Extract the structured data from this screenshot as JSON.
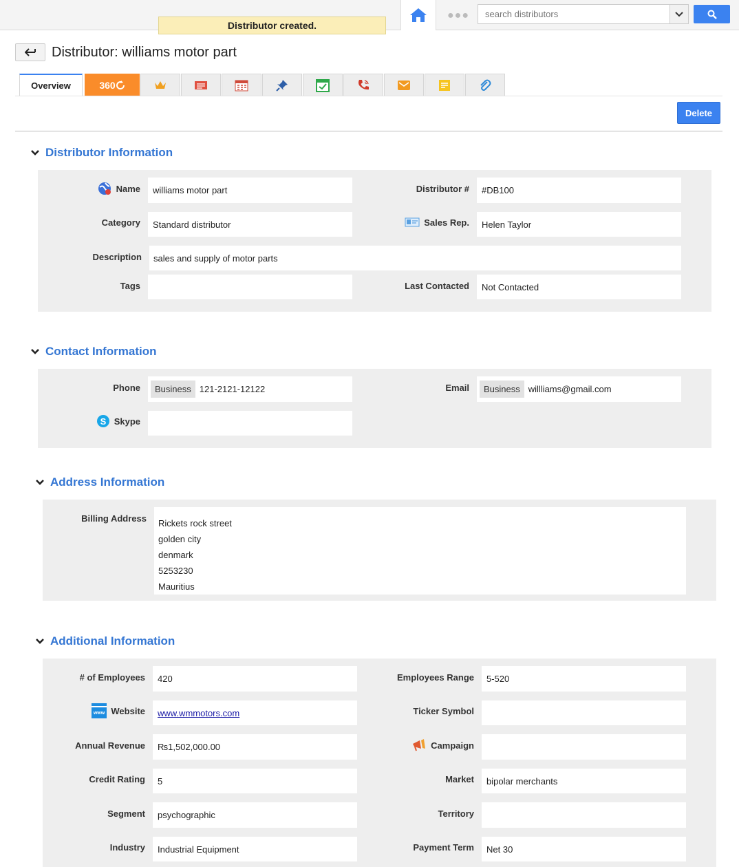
{
  "notice": "Distributor created.",
  "search": {
    "placeholder": "search distributors"
  },
  "page_title": "Distributor: williams motor part",
  "tabs": {
    "overview": "Overview",
    "t360": "360"
  },
  "delete_label": "Delete",
  "sections": {
    "distributor": "Distributor Information",
    "contact": "Contact Information",
    "address": "Address Information",
    "additional": "Additional Information"
  },
  "distributor": {
    "name_label": "Name",
    "name": "williams motor part",
    "number_label": "Distributor #",
    "number": "#DB100",
    "category_label": "Category",
    "category": "Standard distributor",
    "salesrep_label": "Sales Rep.",
    "salesrep": "Helen Taylor",
    "description_label": "Description",
    "description": "sales and supply of motor parts",
    "tags_label": "Tags",
    "tags": "",
    "lastcontacted_label": "Last Contacted",
    "lastcontacted": "Not Contacted"
  },
  "contact": {
    "phone_label": "Phone",
    "phone_type": "Business",
    "phone": "121-2121-12122",
    "email_label": "Email",
    "email_type": "Business",
    "email": "willliams@gmail.com",
    "skype_label": "Skype",
    "skype": ""
  },
  "address": {
    "billing_label": "Billing Address",
    "lines": [
      "Rickets rock street",
      "golden city",
      "denmark",
      "5253230",
      "Mauritius"
    ]
  },
  "additional": {
    "employees_label": "# of Employees",
    "employees": "420",
    "range_label": "Employees Range",
    "range": "5-520",
    "website_label": "Website",
    "website": "www.wmmotors.com",
    "ticker_label": "Ticker Symbol",
    "ticker": "",
    "revenue_label": "Annual Revenue",
    "revenue": "₨1,502,000.00",
    "campaign_label": "Campaign",
    "campaign": "",
    "credit_label": "Credit Rating",
    "credit": "5",
    "market_label": "Market",
    "market": "bipolar merchants",
    "segment_label": "Segment",
    "segment": "psychographic",
    "territory_label": "Territory",
    "territory": "",
    "industry_label": "Industry",
    "industry": "Industrial Equipment",
    "payment_label": "Payment Term",
    "payment": "Net 30"
  },
  "icons": {
    "home": "home-icon",
    "more": "dots-icon",
    "search": "search-icon",
    "back": "back-arrow-icon",
    "accent": "#3b82f0",
    "tab360": "#fa8c2a"
  }
}
